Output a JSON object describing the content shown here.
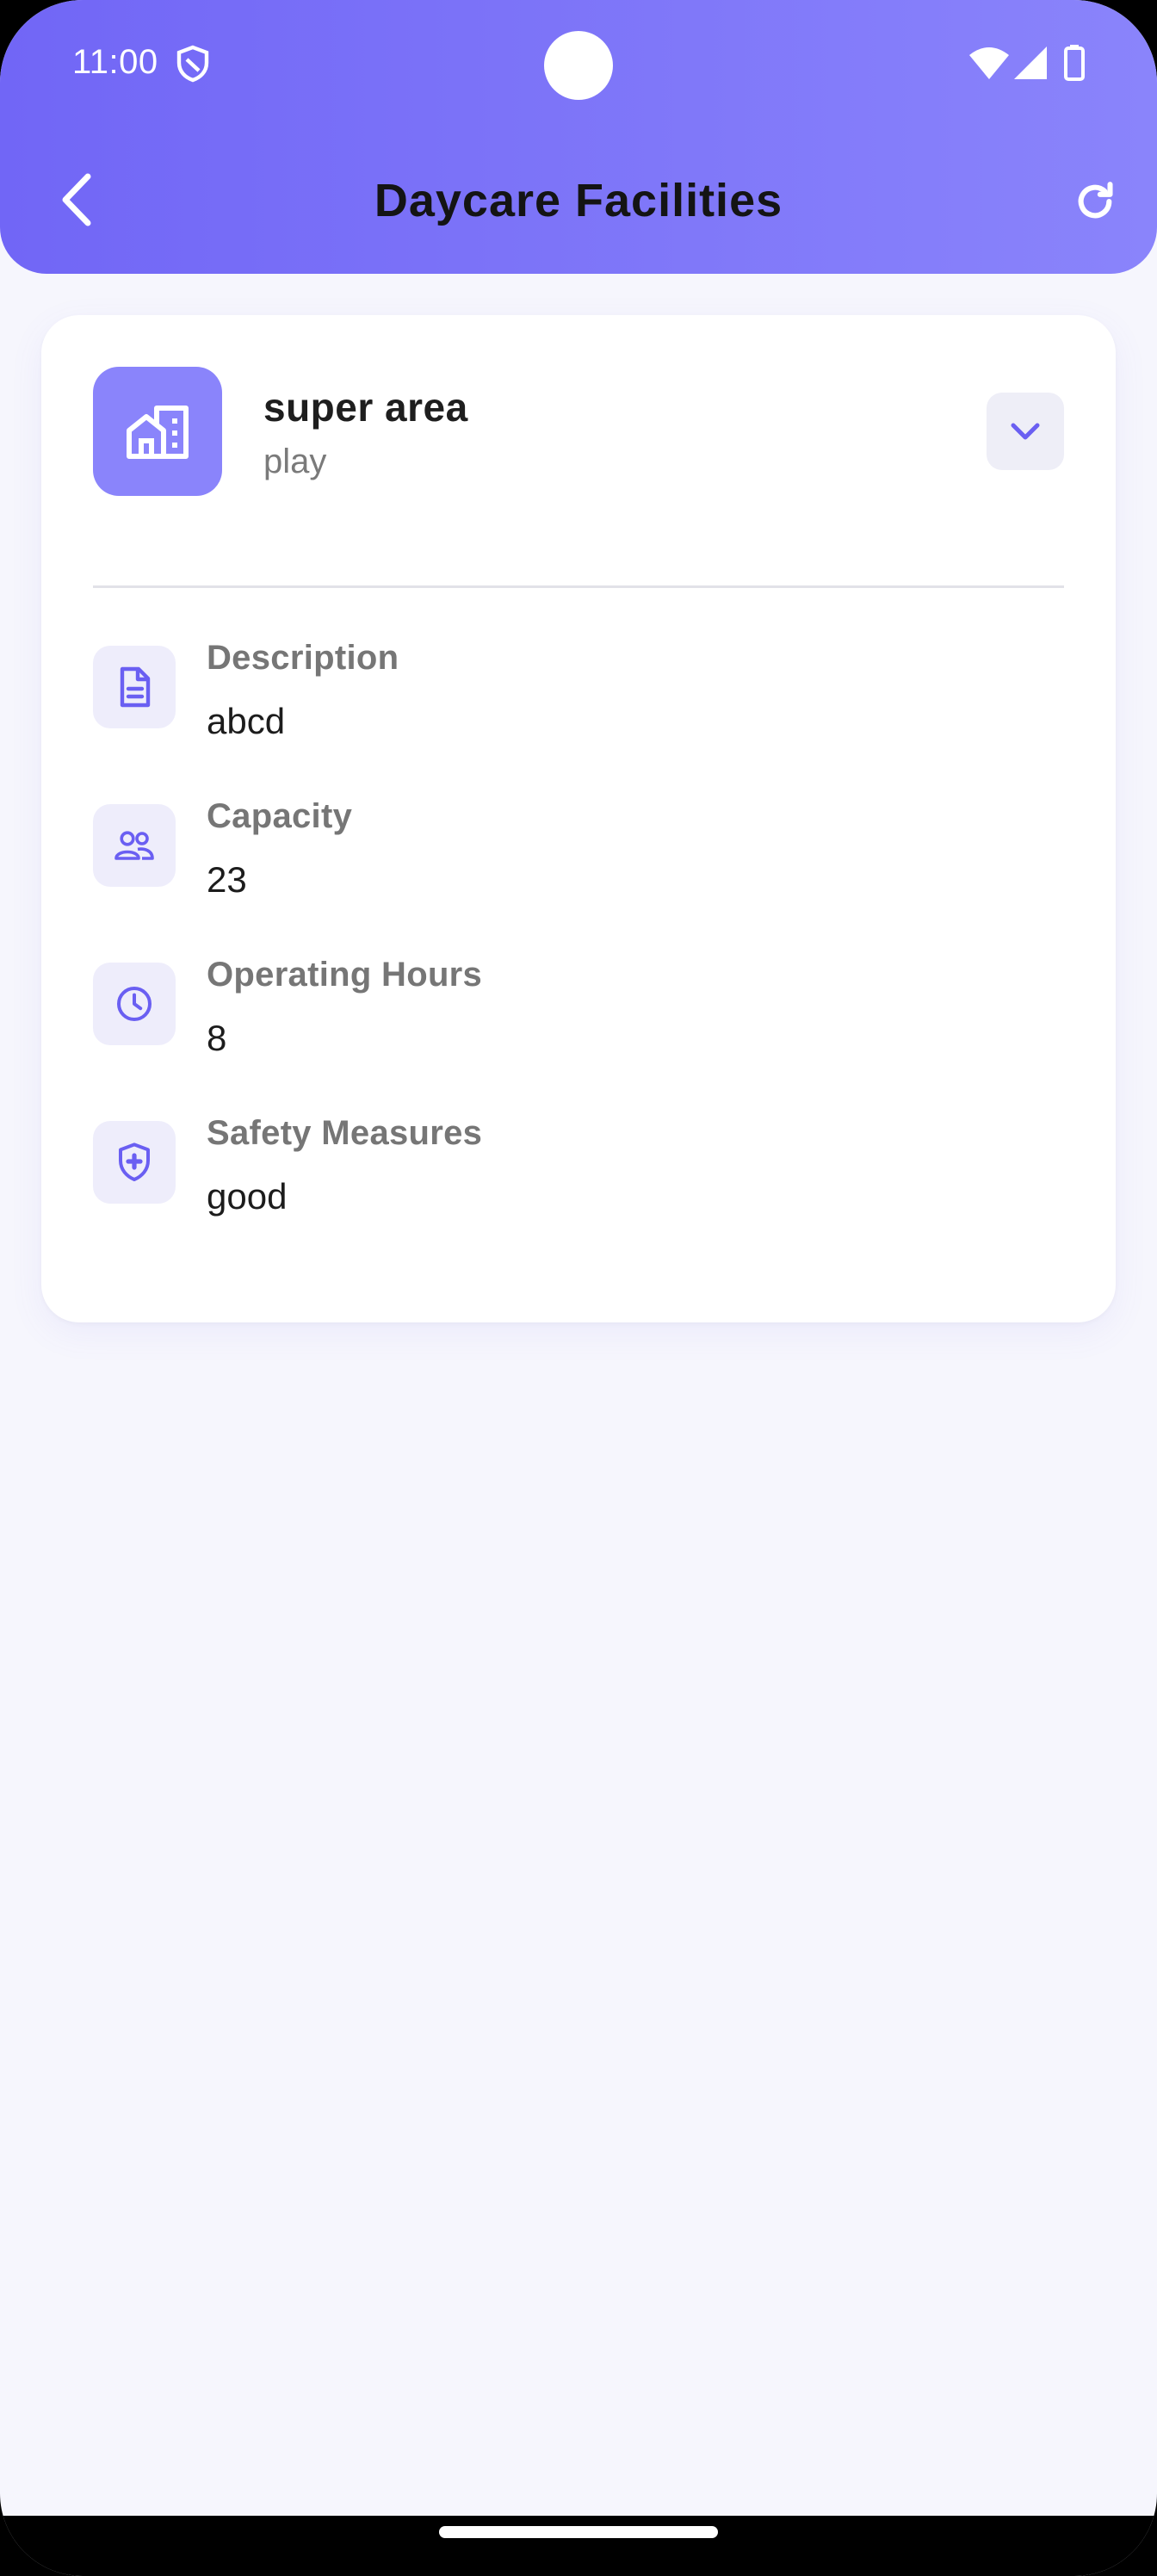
{
  "status_bar": {
    "time": "11:00"
  },
  "app_bar": {
    "title": "Daycare Facilities",
    "back_icon": "chevron-left-icon",
    "refresh_icon": "refresh-icon"
  },
  "facility": {
    "name": "super area",
    "type": "play",
    "icon": "building-icon",
    "expand_icon": "chevron-down-icon",
    "details": [
      {
        "label": "Description",
        "value": "abcd",
        "icon": "document-icon"
      },
      {
        "label": "Capacity",
        "value": "23",
        "icon": "people-icon"
      },
      {
        "label": "Operating Hours",
        "value": "8",
        "icon": "clock-icon"
      },
      {
        "label": "Safety Measures",
        "value": "good",
        "icon": "shield-plus-icon"
      }
    ]
  },
  "colors": {
    "primary": "#7166f6",
    "primary_light": "#8a84fb",
    "background": "#f6f6fd",
    "icon_bg": "#eeedfb"
  }
}
